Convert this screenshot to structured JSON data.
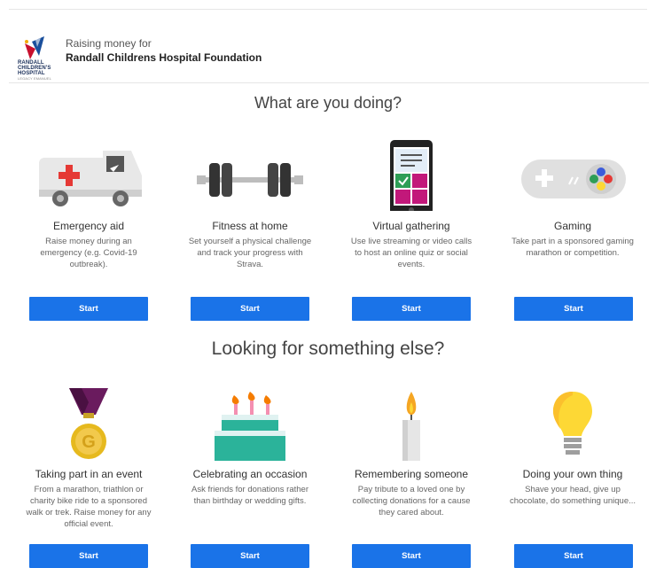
{
  "header": {
    "logo_lines": [
      "RANDALL",
      "CHILDREN'S",
      "HOSPITAL",
      "LEGACY EMANUEL"
    ],
    "raising_label": "Raising money for",
    "charity_name": "Randall Childrens Hospital Foundation"
  },
  "section1": {
    "title": "What are you doing?",
    "cards": [
      {
        "title": "Emergency aid",
        "description": "Raise money during an emergency (e.g. Covid-19 outbreak).",
        "button": "Start",
        "icon": "ambulance-icon"
      },
      {
        "title": "Fitness at home",
        "description": "Set yourself a physical challenge and track your progress with Strava.",
        "button": "Start",
        "icon": "dumbbell-icon"
      },
      {
        "title": "Virtual gathering",
        "description": "Use live streaming or video calls to host an online quiz or social events.",
        "button": "Start",
        "icon": "smartphone-icon"
      },
      {
        "title": "Gaming",
        "description": "Take part in a sponsored gaming marathon or competition.",
        "button": "Start",
        "icon": "gamepad-icon"
      }
    ]
  },
  "section2": {
    "title": "Looking for something else?",
    "cards": [
      {
        "title": "Taking part in an event",
        "description": "From a marathon, triathlon or charity bike ride to a sponsored walk or trek. Raise money for any official event.",
        "button": "Start",
        "icon": "medal-icon"
      },
      {
        "title": "Celebrating an occasion",
        "description": "Ask friends for donations rather than birthday or wedding gifts.",
        "button": "Start",
        "icon": "cake-icon"
      },
      {
        "title": "Remembering someone",
        "description": "Pay tribute to a loved one by collecting donations for a cause they cared about.",
        "button": "Start",
        "icon": "candle-icon"
      },
      {
        "title": "Doing your own thing",
        "description": "Shave your head, give up chocolate, do something unique...",
        "button": "Start",
        "icon": "lightbulb-icon"
      }
    ]
  },
  "colors": {
    "button": "#1a73e8",
    "button_text": "#ffffff"
  }
}
